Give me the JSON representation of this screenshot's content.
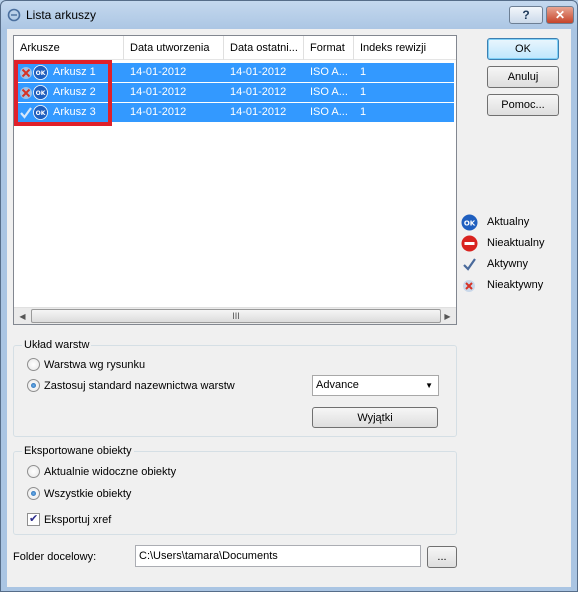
{
  "window": {
    "title": "Lista arkuszy",
    "help_label": "?",
    "close_label": "✕"
  },
  "list": {
    "columns": [
      "Arkusze",
      "Data utworzenia",
      "Data ostatni...",
      "Format",
      "Indeks rewizji"
    ],
    "rows": [
      {
        "state": "inactive",
        "name": "Arkusz 1",
        "created": "14-01-2012",
        "modified": "14-01-2012",
        "format": "ISO A...",
        "revision": "1"
      },
      {
        "state": "inactive",
        "name": "Arkusz 2",
        "created": "14-01-2012",
        "modified": "14-01-2012",
        "format": "ISO A...",
        "revision": "1"
      },
      {
        "state": "active",
        "name": "Arkusz 3",
        "created": "14-01-2012",
        "modified": "14-01-2012",
        "format": "ISO A...",
        "revision": "1"
      }
    ],
    "scroll_grip": "III"
  },
  "buttons": {
    "ok": "OK",
    "cancel": "Anuluj",
    "help": "Pomoc..."
  },
  "legend": {
    "current": "Aktualny",
    "outdated": "Nieaktualny",
    "active": "Aktywny",
    "inactive": "Nieaktywny"
  },
  "layers": {
    "title": "Układ warstw",
    "option_drawing": "Warstwa wg rysunku",
    "option_standard": "Zastosuj standard nazewnictwa warstw",
    "standard_value": "Advance",
    "exceptions_button": "Wyjątki"
  },
  "exported": {
    "title": "Eksportowane obiekty",
    "option_visible": "Aktualnie widoczne obiekty",
    "option_all": "Wszystkie obiekty",
    "xref_label": "Eksportuj xref"
  },
  "destination": {
    "label": "Folder docelowy:",
    "path": "C:\\Users\\tamara\\Documents",
    "browse_label": "..."
  },
  "colors": {
    "selection": "#3399ff",
    "highlight_box": "#e0202a",
    "ok_icon": "#1f5fbf",
    "outdated_icon": "#d9231f"
  }
}
